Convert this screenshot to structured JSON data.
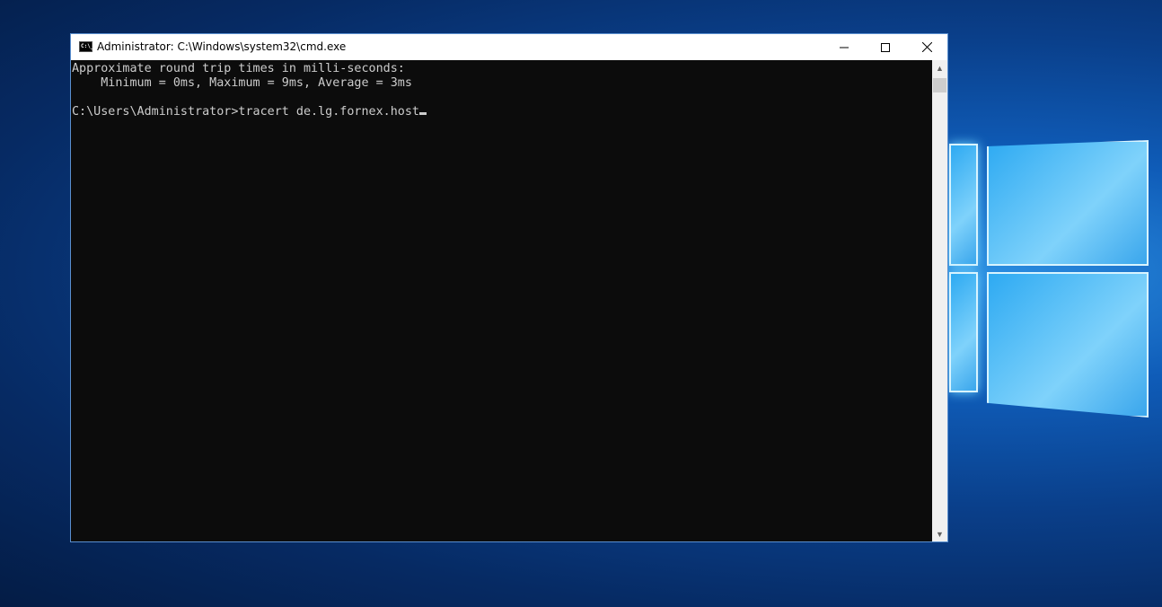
{
  "window": {
    "title": "Administrator: C:\\Windows\\system32\\cmd.exe",
    "icon": "cmd-icon",
    "controls": {
      "minimize": "minimize-icon",
      "maximize": "maximize-icon",
      "close": "close-icon"
    }
  },
  "console": {
    "lines": [
      "Approximate round trip times in milli-seconds:",
      "    Minimum = 0ms, Maximum = 9ms, Average = 3ms",
      "",
      "C:\\Users\\Administrator>tracert de.lg.fornex.host"
    ]
  },
  "colors": {
    "console_bg": "#0c0c0c",
    "console_fg": "#cccccc",
    "desktop_accent": "#0f5cb8"
  }
}
